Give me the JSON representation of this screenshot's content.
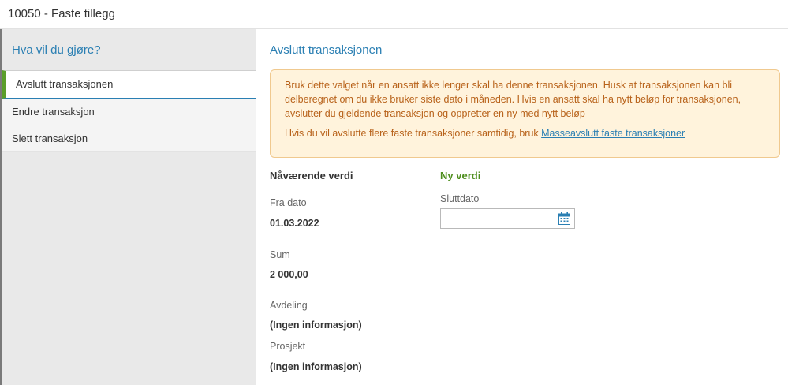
{
  "window": {
    "title": "10050 - Faste tillegg"
  },
  "sidebar": {
    "heading": "Hva vil du gjøre?",
    "items": [
      {
        "label": "Avslutt transaksjonen",
        "active": true
      },
      {
        "label": "Endre transaksjon",
        "active": false
      },
      {
        "label": "Slett transaksjon",
        "active": false
      }
    ]
  },
  "main": {
    "title": "Avslutt transaksjonen",
    "notice": {
      "text": "Bruk dette valget når en ansatt ikke lenger skal ha denne transaksjonen. Husk at transaksjonen kan bli delberegnet om du ikke bruker siste dato i måneden. Hvis en ansatt skal ha nytt beløp for transaksjonen, avslutter du gjeldende transaksjon og oppretter en ny med nytt beløp",
      "second_prefix": "Hvis du vil avslutte flere faste transaksjoner samtidig, bruk ",
      "link": "Masseavslutt faste transaksjoner"
    },
    "current": {
      "heading": "Nåværende verdi",
      "fields": [
        {
          "label": "Fra dato",
          "value": "01.03.2022"
        },
        {
          "label": "Sum",
          "value": "2 000,00"
        },
        {
          "label": "Avdeling",
          "value": "(Ingen informasjon)"
        },
        {
          "label": "Prosjekt",
          "value": "(Ingen informasjon)"
        }
      ]
    },
    "new": {
      "heading": "Ny verdi",
      "end_date_label": "Sluttdato",
      "end_date_value": ""
    }
  },
  "icons": {
    "calendar": "calendar-icon"
  },
  "colors": {
    "accent": "#2a7fb3",
    "active_marker": "#5a9e2a",
    "notice_text": "#b8621a",
    "notice_bg": "#fff3dc",
    "new_heading": "#4f8f1f"
  }
}
